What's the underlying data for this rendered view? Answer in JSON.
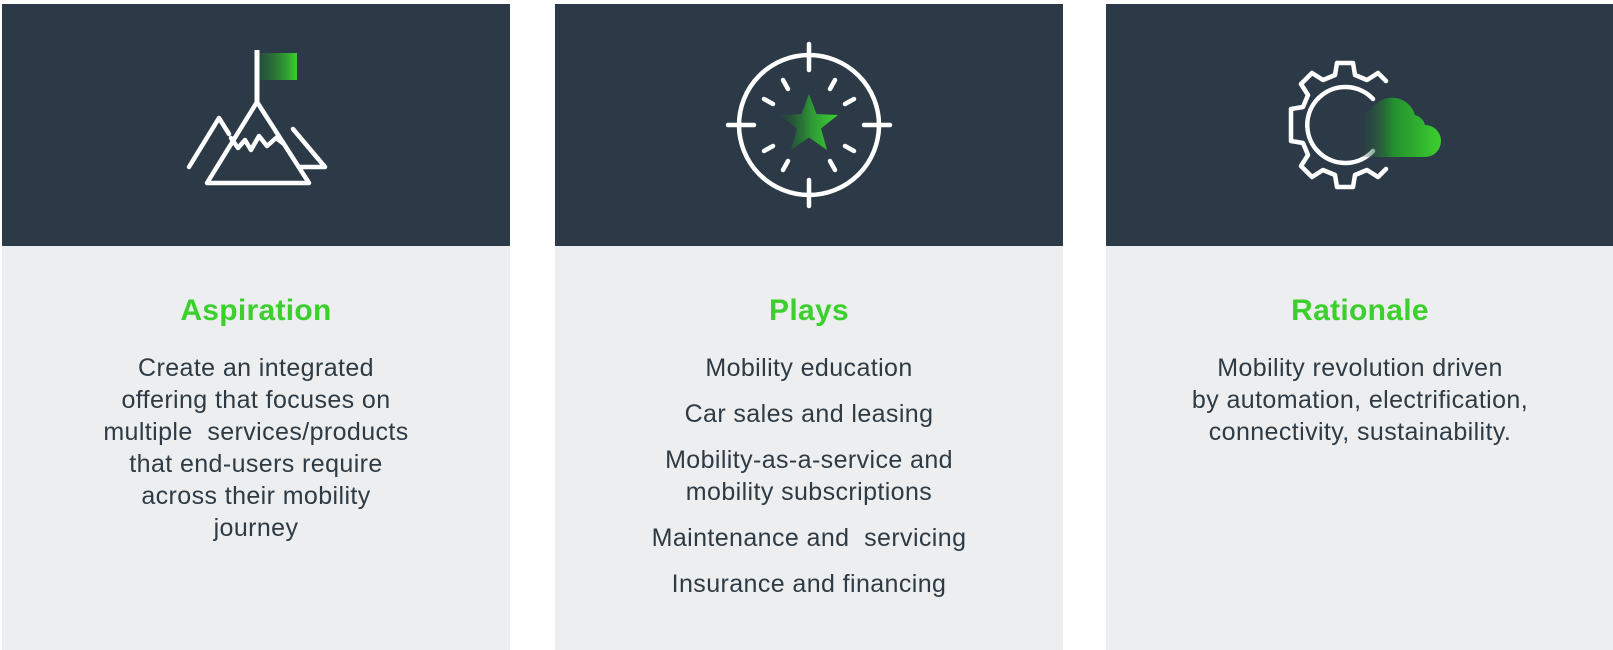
{
  "cards": [
    {
      "title": "Aspiration",
      "icon": "mountain-flag-icon",
      "body_lines": [
        "Create an integrated",
        "offering that focuses on",
        "multiple  services/products",
        "that end-users require",
        "across their mobility",
        "journey"
      ]
    },
    {
      "title": "Plays",
      "icon": "target-star-icon",
      "items": [
        [
          "Mobility education"
        ],
        [
          "Car sales and leasing"
        ],
        [
          "Mobility-as-a-service and",
          "mobility subscriptions"
        ],
        [
          "Maintenance and  servicing"
        ],
        [
          "Insurance and financing"
        ]
      ]
    },
    {
      "title": "Rationale",
      "icon": "gear-cloud-icon",
      "body_lines": [
        "Mobility revolution driven",
        "by automation, electrification,",
        "connectivity, sustainability."
      ]
    }
  ],
  "colors": {
    "header_background": "#2b3a46",
    "card_background": "#eceeef",
    "title_green": "#3ccf2e",
    "body_text": "#2e3a44"
  }
}
